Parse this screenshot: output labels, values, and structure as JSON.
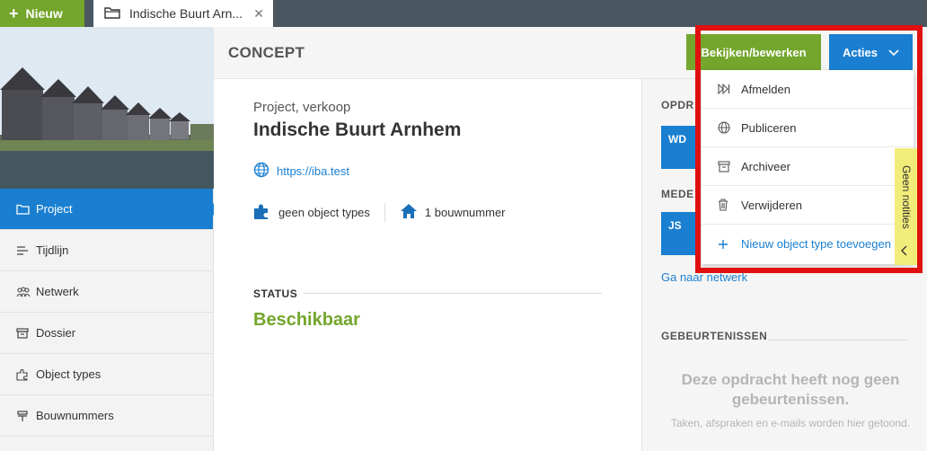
{
  "topbar": {
    "new_label": "Nieuw",
    "tab_title": "Indische Buurt Arn...",
    "close_symbol": "✕"
  },
  "sidebar": {
    "items": [
      {
        "label": "Project",
        "icon": "folder-icon",
        "active": true
      },
      {
        "label": "Tijdlijn",
        "icon": "timeline-icon"
      },
      {
        "label": "Netwerk",
        "icon": "network-icon"
      },
      {
        "label": "Dossier",
        "icon": "archive-icon"
      },
      {
        "label": "Object types",
        "icon": "object-types-icon"
      },
      {
        "label": "Bouwnummers",
        "icon": "building-numbers-icon"
      }
    ]
  },
  "header": {
    "status_title": "CONCEPT",
    "view_edit_label": "Bekijken/bewerken",
    "actions_label": "Acties"
  },
  "project": {
    "type": "Project, verkoop",
    "title": "Indische Buurt Arnhem",
    "url": "https://iba.test",
    "object_types": "geen object types",
    "build_numbers": "1 bouwnummer",
    "status_label": "STATUS",
    "status_value": "Beschikbaar"
  },
  "right": {
    "opdr_heading": "OPDR",
    "opdr_avatar": "WD",
    "mede_heading": "MEDE",
    "mede_avatar": "JS",
    "network_link": "Ga naar netwerk",
    "events_heading": "GEBEURTENISSEN",
    "empty_title": "Deze opdracht heeft nog geen gebeurtenissen.",
    "empty_sub": "Taken, afspraken en e-mails worden hier getoond."
  },
  "actions_menu": {
    "items": [
      {
        "label": "Afmelden",
        "icon": "skip-forward-icon"
      },
      {
        "label": "Publiceren",
        "icon": "globe-icon"
      },
      {
        "label": "Archiveer",
        "icon": "archive-box-icon"
      },
      {
        "label": "Verwijderen",
        "icon": "trash-icon"
      },
      {
        "label": "Nieuw object type toevoegen",
        "icon": "plus-icon"
      }
    ]
  },
  "notes": {
    "label": "Geen notities"
  },
  "colors": {
    "green": "#74a52c",
    "blue": "#1a7fd0",
    "highlight": "#e01010",
    "notes_yellow": "#f2ec7a"
  }
}
